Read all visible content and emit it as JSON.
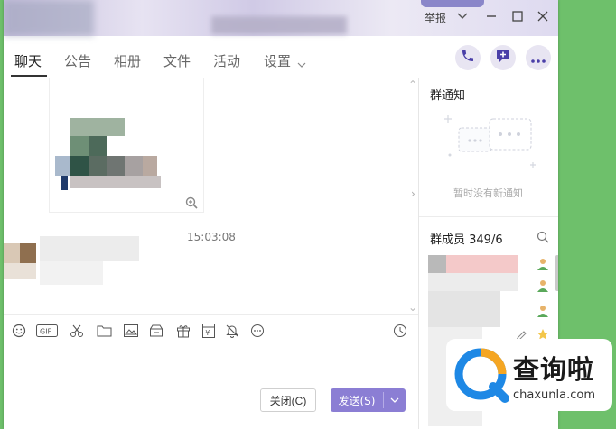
{
  "window": {
    "report_label": "举报"
  },
  "tabs": [
    {
      "label": "聊天"
    },
    {
      "label": "公告"
    },
    {
      "label": "相册"
    },
    {
      "label": "文件"
    },
    {
      "label": "活动"
    },
    {
      "label": "设置"
    }
  ],
  "chat": {
    "timestamp": "15:03:08"
  },
  "composer": {
    "close_label": "关闭(C)",
    "send_label": "发送(S)"
  },
  "sidebar": {
    "notice_title": "群通知",
    "notice_empty": "暂时没有新通知",
    "members_title": "群成员 349/6"
  },
  "watermark": {
    "cn": "查询啦",
    "en": "chaxunla.com"
  },
  "colors": {
    "accent": "#8b7ed4",
    "background": "#6ec06b"
  }
}
